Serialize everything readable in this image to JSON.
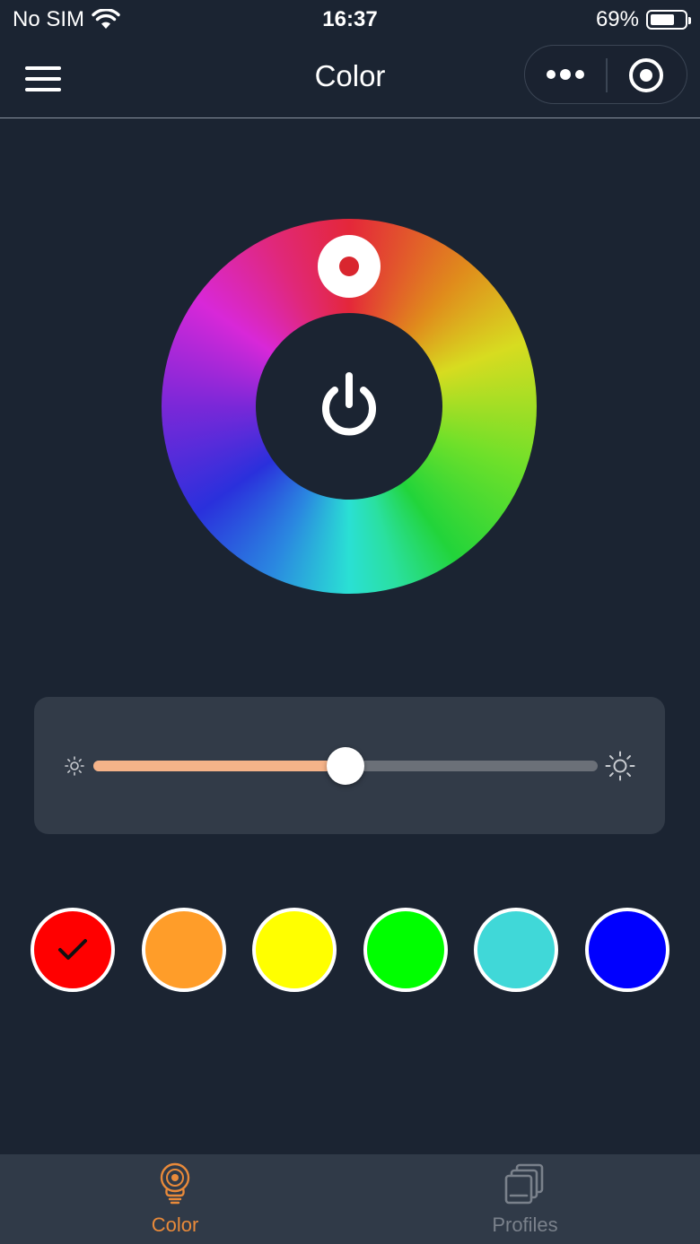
{
  "status_bar": {
    "carrier": "No SIM",
    "time": "16:37",
    "battery": "69%",
    "battery_level": 0.69
  },
  "nav": {
    "title": "Color",
    "menu_icon": "hamburger-icon",
    "more_icon": "more-dots-icon",
    "close_icon": "target-circle-icon"
  },
  "color_wheel": {
    "selected_color": "#d9262f",
    "power_icon": "power-icon"
  },
  "brightness": {
    "value": 0.5,
    "min_icon": "sun-small-icon",
    "max_icon": "sun-large-icon",
    "fill_color": "#f5b389"
  },
  "swatches": [
    {
      "color": "#ff0000",
      "selected": true
    },
    {
      "color": "#ff9d29",
      "selected": false
    },
    {
      "color": "#ffff00",
      "selected": false
    },
    {
      "color": "#00ff00",
      "selected": false
    },
    {
      "color": "#40d8d8",
      "selected": false
    },
    {
      "color": "#0000ff",
      "selected": false
    }
  ],
  "tabs": [
    {
      "label": "Color",
      "icon": "color-bulb-icon",
      "active": true
    },
    {
      "label": "Profiles",
      "icon": "profiles-stack-icon",
      "active": false
    }
  ],
  "colors": {
    "background": "#1b2432",
    "accent": "#e98a3a",
    "panel": "#323b48",
    "tab_bar": "#303a48"
  }
}
